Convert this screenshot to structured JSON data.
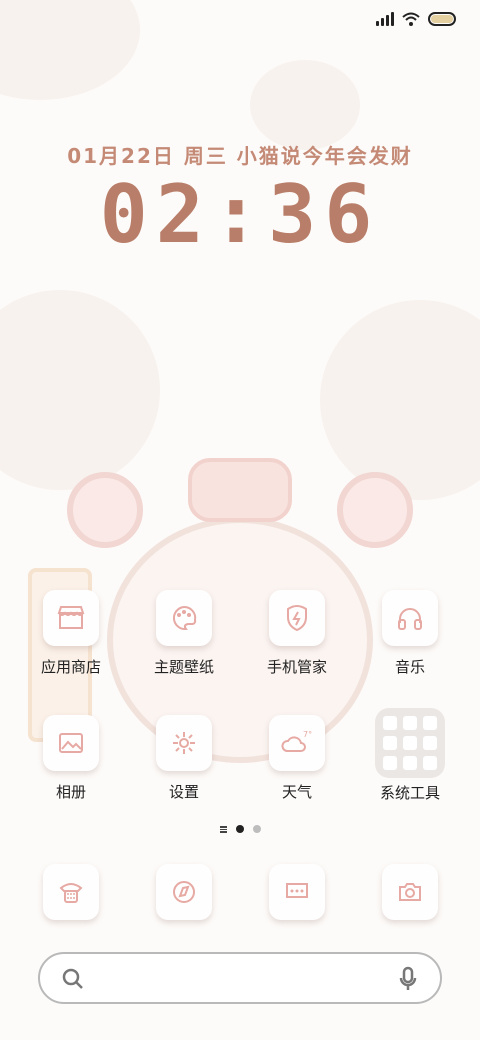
{
  "status_bar": {
    "icons": [
      "signal-icon",
      "wifi-icon",
      "battery-icon"
    ]
  },
  "clock": {
    "date_text": "01月22日 周三 小猫说今年会发财",
    "time": "02:36"
  },
  "apps_row1": [
    {
      "label": "应用商店",
      "icon": "store-icon"
    },
    {
      "label": "主题壁纸",
      "icon": "palette-icon"
    },
    {
      "label": "手机管家",
      "icon": "shield-bolt-icon"
    },
    {
      "label": "音乐",
      "icon": "headphones-icon"
    }
  ],
  "apps_row2": [
    {
      "label": "相册",
      "icon": "gallery-icon"
    },
    {
      "label": "设置",
      "icon": "gear-icon"
    },
    {
      "label": "天气",
      "icon": "weather-icon"
    },
    {
      "label": "系统工具",
      "icon": "folder-icon"
    }
  ],
  "dock": [
    {
      "icon": "phone-icon"
    },
    {
      "icon": "browser-icon"
    },
    {
      "icon": "message-icon"
    },
    {
      "icon": "camera-icon"
    }
  ],
  "colors": {
    "accent": "#b97e69",
    "icon_line": "#e6a9a3"
  }
}
